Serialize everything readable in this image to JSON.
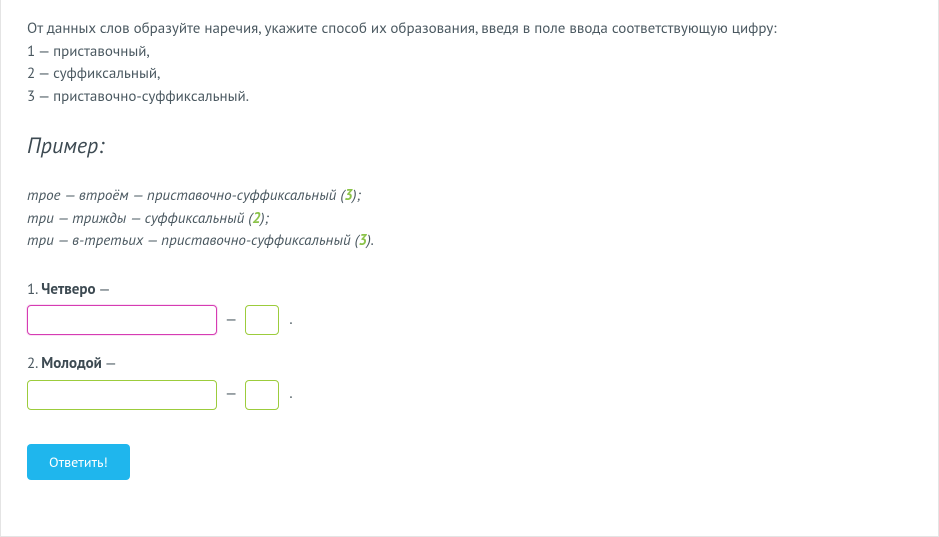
{
  "instructions": {
    "intro": "От данных слов образуйте наречия, укажите способ их образования, введя в поле ввода соответствующую цифру:",
    "options": [
      "1 — приставочный,",
      "2 — суффиксальный,",
      "3 — приставочно-суффиксальный."
    ]
  },
  "example_heading": "Пример:",
  "examples": [
    {
      "prefix": "трое — втроём — приставочно-суффиксальный (",
      "num": "3",
      "suffix": ");"
    },
    {
      "prefix": "три — трижды — суффиксальный (",
      "num": "2",
      "suffix": ");"
    },
    {
      "prefix": "три — в-третьих — приставочно-суффиксальный (",
      "num": "3",
      "suffix": ")."
    }
  ],
  "tasks": [
    {
      "index": "1.",
      "word": "Четверо",
      "trail": " —",
      "word_value": "",
      "num_value": "",
      "focused": true
    },
    {
      "index": "2.",
      "word": "Молодой",
      "trail": " —",
      "word_value": "",
      "num_value": "",
      "focused": false
    }
  ],
  "submit_label": "Ответить!",
  "dash": "—",
  "period": "."
}
